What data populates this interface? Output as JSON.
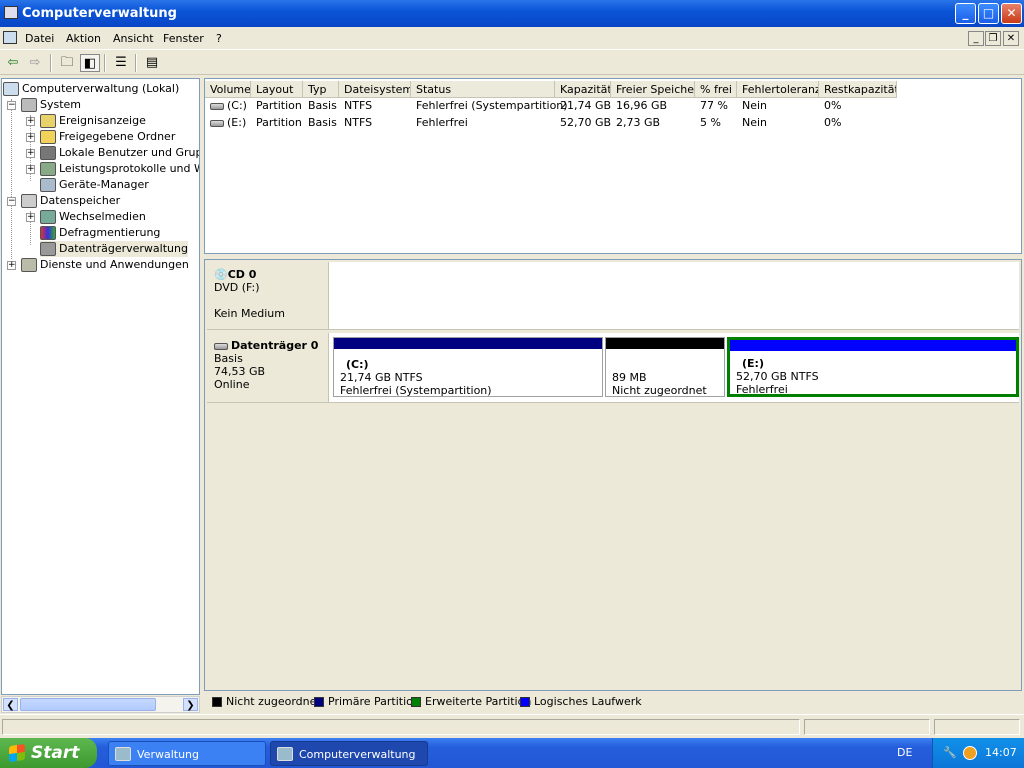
{
  "window": {
    "title": "Computerverwaltung"
  },
  "window_buttons": {
    "minimize": "_",
    "maximize": "□",
    "close": "✕"
  },
  "menu": [
    "Datei",
    "Aktion",
    "Ansicht",
    "Fenster",
    "?"
  ],
  "mdi_buttons": {
    "minimize": "_",
    "restore": "❐",
    "close": "✕"
  },
  "toolbar": {
    "back_icon": "back-arrow-icon",
    "forward_icon": "forward-arrow-icon",
    "up_icon": "up-folder-icon",
    "show_tree_icon": "show-hide-tree-icon",
    "properties_icon": "properties-icon",
    "help_icon": "help-icon"
  },
  "tree": {
    "root": "Computerverwaltung (Lokal)",
    "system": "System",
    "system_children": [
      "Ereignisanzeige",
      "Freigegebene Ordner",
      "Lokale Benutzer und Gruppen",
      "Leistungsprotokolle und Warnungen",
      "Geräte-Manager"
    ],
    "storage": "Datenspeicher",
    "storage_children": [
      "Wechselmedien",
      "Defragmentierung",
      "Datenträgerverwaltung"
    ],
    "services": "Dienste und Anwendungen",
    "selected": "Datenträgerverwaltung"
  },
  "volume_table": {
    "columns": [
      "Volume",
      "Layout",
      "Typ",
      "Dateisystem",
      "Status",
      "Kapazität",
      "Freier Speicher",
      "% frei",
      "Fehlertoleranz",
      "Restkapazität"
    ],
    "rows": [
      [
        "(C:)",
        "Partition",
        "Basis",
        "NTFS",
        "Fehlerfrei (Systempartition)",
        "21,74 GB",
        "16,96 GB",
        "77 %",
        "Nein",
        "0%"
      ],
      [
        "(E:)",
        "Partition",
        "Basis",
        "NTFS",
        "Fehlerfrei",
        "52,70 GB",
        "2,73 GB",
        "5 %",
        "Nein",
        "0%"
      ]
    ]
  },
  "disks": {
    "cd": {
      "name": "CD 0",
      "type": "DVD (F:)",
      "status": "Kein Medium"
    },
    "disk0": {
      "name": "Datenträger 0",
      "type": "Basis",
      "size": "74,53 GB",
      "status": "Online",
      "partitions": [
        {
          "label": "(C:)",
          "size": "21,74 GB NTFS",
          "status": "Fehlerfrei (Systempartition)",
          "color": "#000080"
        },
        {
          "label": "",
          "size": "89 MB",
          "status": "Nicht zugeordnet",
          "color": "#000000"
        },
        {
          "label": "(E:)",
          "size": "52,70 GB NTFS",
          "status": "Fehlerfrei",
          "color": "#0000ff",
          "selected": true,
          "border_color": "#008000"
        }
      ]
    }
  },
  "legend": [
    {
      "label": "Nicht zugeordnet",
      "color": "#000000"
    },
    {
      "label": "Primäre Partition",
      "color": "#000080"
    },
    {
      "label": "Erweiterte Partition",
      "color": "#008000"
    },
    {
      "label": "Logisches Laufwerk",
      "color": "#0000ff"
    }
  ],
  "taskbar": {
    "start": "Start",
    "apps": [
      "Verwaltung",
      "Computerverwaltung"
    ],
    "active_app": "Computerverwaltung",
    "language": "DE",
    "clock": "14:07"
  }
}
